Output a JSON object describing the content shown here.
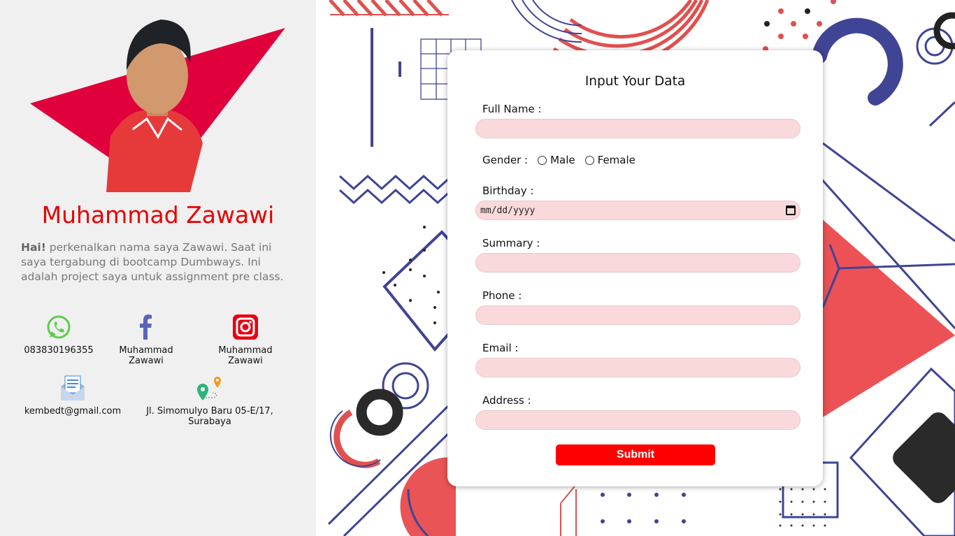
{
  "profile": {
    "name": "Muhammad Zawawi",
    "bio_greeting": "Hai!",
    "bio_text": " perkenalkan nama saya Zawawi. Saat ini saya tergabung di bootcamp Dumbways. Ini adalah project saya untuk assignment pre class.",
    "accent_color": "#e60000",
    "contacts": [
      {
        "icon": "whatsapp-icon",
        "label": "083830196355"
      },
      {
        "icon": "facebook-icon",
        "label": "Muhammad Zawawi"
      },
      {
        "icon": "instagram-icon",
        "label": "Muhammad Zawawi"
      },
      {
        "icon": "email-icon",
        "label": "kembedt@gmail.com"
      },
      {
        "icon": "map-pin-icon",
        "label": "Jl. Simomulyo Baru 05-E/17, Surabaya"
      }
    ]
  },
  "form": {
    "title": "Input Your Data",
    "full_name_label": "Full Name :",
    "full_name_value": "",
    "gender_label": "Gender :",
    "gender_options": [
      "Male",
      "Female"
    ],
    "birthday_label": "Birthday :",
    "birthday_placeholder": "mm/dd/yyyy",
    "summary_label": "Summary :",
    "summary_value": "",
    "phone_label": "Phone :",
    "phone_value": "",
    "email_label": "Email :",
    "email_value": "",
    "address_label": "Address :",
    "address_value": "",
    "submit_label": "Submit",
    "field_color": "#f9d9db",
    "submit_color": "#ff0000"
  }
}
